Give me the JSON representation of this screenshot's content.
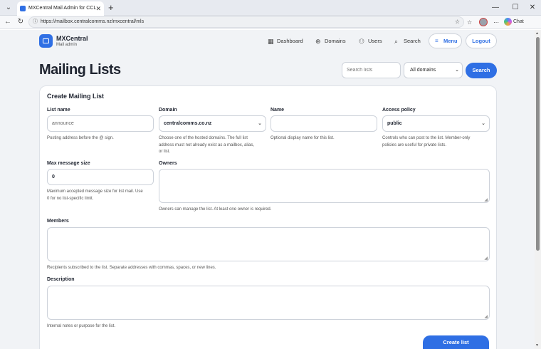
{
  "browser": {
    "tab_title": "MXCentral Mail Admin for CCL",
    "url": "https://mailbox.centralcomms.nz/mxcentral/mls",
    "chat_label": "Chat"
  },
  "header": {
    "brand_name": "MXCentral",
    "brand_sub": "Mail admin",
    "nav": [
      {
        "label": "Dashboard",
        "icon": "dashboard-icon"
      },
      {
        "label": "Domains",
        "icon": "globe-icon"
      },
      {
        "label": "Users",
        "icon": "users-icon"
      },
      {
        "label": "Search",
        "icon": "search-icon"
      }
    ],
    "menu_label": "Menu",
    "logout_label": "Logout"
  },
  "page": {
    "title": "Mailing Lists",
    "search_placeholder": "Search lists",
    "domain_filter": "All domains",
    "search_button": "Search"
  },
  "form": {
    "title": "Create Mailing List",
    "list_name": {
      "label": "List name",
      "placeholder": "announce",
      "help": "Posting address before the @ sign."
    },
    "domain": {
      "label": "Domain",
      "value": "centralcomms.co.nz",
      "help_lines": [
        "Choose one of the hosted domains. The full list",
        "address must not already exist as a mailbox, alias,",
        "or list."
      ]
    },
    "name": {
      "label": "Name",
      "value": "",
      "help": "Optional display name for this list."
    },
    "access_policy": {
      "label": "Access policy",
      "value": "public",
      "help_lines": [
        "Controls who can post to the list. Member-only",
        "policies are useful for private lists."
      ]
    },
    "max_size": {
      "label": "Max message size",
      "value": "0",
      "help_lines": [
        "Maximum accepted message size for list mail. Use",
        "0 for no list-specific limit."
      ]
    },
    "owners": {
      "label": "Owners",
      "help": "Owners can manage the list. At least one owner is required."
    },
    "members": {
      "label": "Members",
      "help": "Recipients subscribed to the list. Separate addresses with commas, spaces, or new lines."
    },
    "description": {
      "label": "Description",
      "help": "Internal notes or purpose for the list."
    },
    "submit_label": "Create list"
  },
  "colors": {
    "accent": "#2f6fe4",
    "page_bg": "#f1f3f6"
  }
}
